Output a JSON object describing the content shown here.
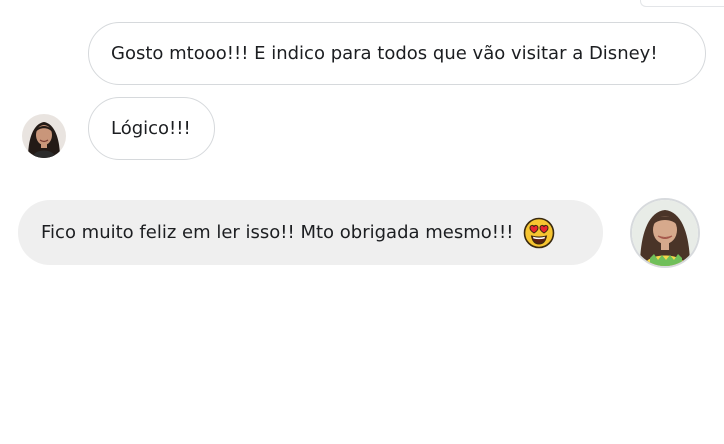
{
  "conversation": {
    "messages": [
      {
        "text": "Gosto mtooo!!! E indico para todos que vão visitar a Disney!",
        "sender": "other"
      },
      {
        "text": "Lógico!!!",
        "sender": "other"
      },
      {
        "text": "Fico muito feliz em ler isso!! Mto obrigada mesmo!!!",
        "sender": "self",
        "emoji": "heart-eyes-emoji"
      }
    ],
    "colors": {
      "outline_bubble_border": "#d6d9dc",
      "filled_bubble_bg": "#efefef",
      "text": "#1c1e21"
    }
  }
}
